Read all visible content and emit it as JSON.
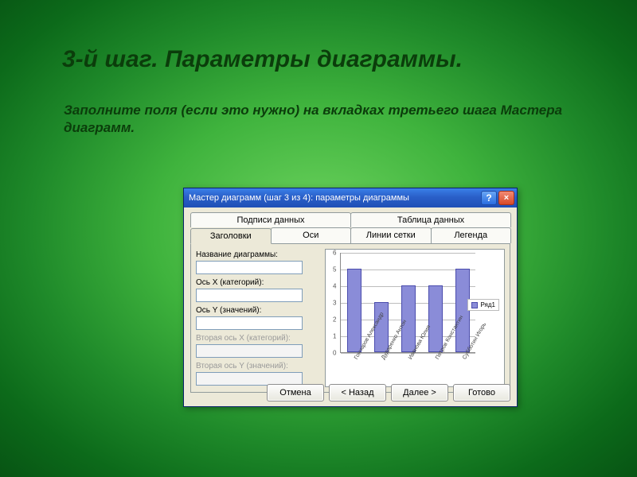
{
  "slide": {
    "title": "3-й шаг. Параметры диаграммы.",
    "subtitle": "Заполните поля (если это нужно) на вкладках третьего шага Мастера диаграмм."
  },
  "dialog": {
    "title": "Мастер диаграмм (шаг 3 из 4): параметры диаграммы",
    "help_btn": "?",
    "close_btn": "×",
    "tabs_row1": [
      "Подписи данных",
      "Таблица данных"
    ],
    "tabs_row2": [
      "Заголовки",
      "Оси",
      "Линии сетки",
      "Легенда"
    ],
    "active_tab": "Заголовки",
    "fields": {
      "chart_title_label": "Название диаграммы:",
      "chart_title_value": "",
      "axis_x_label": "Ось X (категорий):",
      "axis_x_value": "",
      "axis_y_label": "Ось Y (значений):",
      "axis_y_value": "",
      "axis_x2_label": "Вторая ось X (категорий):",
      "axis_x2_value": "",
      "axis_y2_label": "Вторая ось Y (значений):",
      "axis_y2_value": ""
    },
    "buttons": {
      "cancel": "Отмена",
      "back": "< Назад",
      "next": "Далее >",
      "finish": "Готово"
    }
  },
  "chart_data": {
    "type": "bar",
    "categories": [
      "Гончаров Александр",
      "Дударенко Антон",
      "Иванова Юлия",
      "Петров Константин",
      "Субботин Игорь"
    ],
    "values": [
      5,
      3,
      4,
      4,
      5
    ],
    "title": "",
    "xlabel": "",
    "ylabel": "",
    "ylim": [
      0,
      6
    ],
    "series_name": "Ряд1"
  }
}
